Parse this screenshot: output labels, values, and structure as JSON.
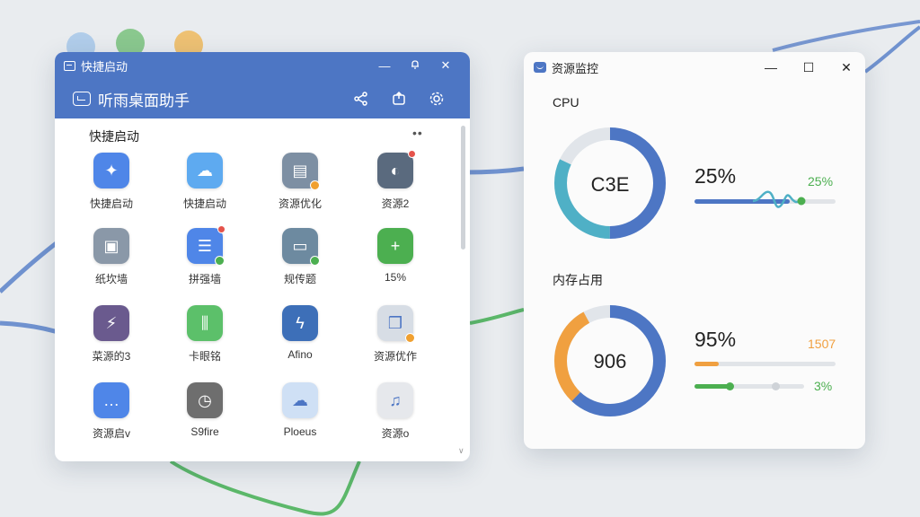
{
  "launcher": {
    "title": "快捷启动",
    "header_title": "听雨桌面助手",
    "section_title": "快捷启动",
    "more": "••",
    "apps": [
      {
        "label": "快捷启动",
        "icon": "sparkle-icon",
        "color": "#4f86e8",
        "glyph": "✦"
      },
      {
        "label": "快捷启动",
        "icon": "cloud-icon",
        "color": "#5eaaf0",
        "glyph": "☁"
      },
      {
        "label": "资源优化",
        "icon": "chat-bubble-icon",
        "color": "#7d8fa3",
        "glyph": "▤"
      },
      {
        "label": "资源2",
        "icon": "palette-icon",
        "color": "#5a6a7e",
        "glyph": "◐"
      },
      {
        "label": "纸坎墙",
        "icon": "briefcase-icon",
        "color": "#8a98a8",
        "glyph": "▣"
      },
      {
        "label": "拼强墙",
        "icon": "document-icon",
        "color": "#4f86e8",
        "glyph": "☰"
      },
      {
        "label": "规传题",
        "icon": "inbox-icon",
        "color": "#6d8aa0",
        "glyph": "▭"
      },
      {
        "label": "15%",
        "icon": "plus-icon",
        "color": "#4caf50",
        "glyph": "+"
      },
      {
        "label": "菜源的3",
        "icon": "lightning-icon",
        "color": "#6a5a8e",
        "glyph": "⚡"
      },
      {
        "label": "卡眼铭",
        "icon": "equalizer-icon",
        "color": "#5cc06a",
        "glyph": "⫼"
      },
      {
        "label": "Afino",
        "icon": "bolt-icon",
        "color": "#3d6fb8",
        "glyph": "ϟ"
      },
      {
        "label": "资源优作",
        "icon": "cube-icon",
        "color": "#d7dde5",
        "glyph": "❒"
      },
      {
        "label": "资源启v",
        "icon": "chat-icon",
        "color": "#4f86e8",
        "glyph": "…"
      },
      {
        "label": "S9fire",
        "icon": "clock-icon",
        "color": "#6e6e6e",
        "glyph": "◷"
      },
      {
        "label": "Ploeus",
        "icon": "cloud-app-icon",
        "color": "#cfe0f5",
        "glyph": "☁"
      },
      {
        "label": "资源o",
        "icon": "music-icon",
        "color": "#e6e8ec",
        "glyph": "♫"
      }
    ]
  },
  "monitor": {
    "title": "资源监控",
    "cpu_label": "CPU",
    "cpu_center": "C3E",
    "cpu_big": "25%",
    "cpu_small": "25%",
    "cpu_value": 0.25,
    "mem_label": "内存占用",
    "mem_center": "906",
    "mem_big": "95%",
    "mem_small1": "1507",
    "mem_small2": "3%",
    "mem_bar1_value": 0.05,
    "mem_bar2_value": 0.32,
    "colors": {
      "blue": "#4d76c4",
      "teal": "#4fb0c6",
      "green": "#4caf50",
      "orange": "#f0a040"
    }
  }
}
